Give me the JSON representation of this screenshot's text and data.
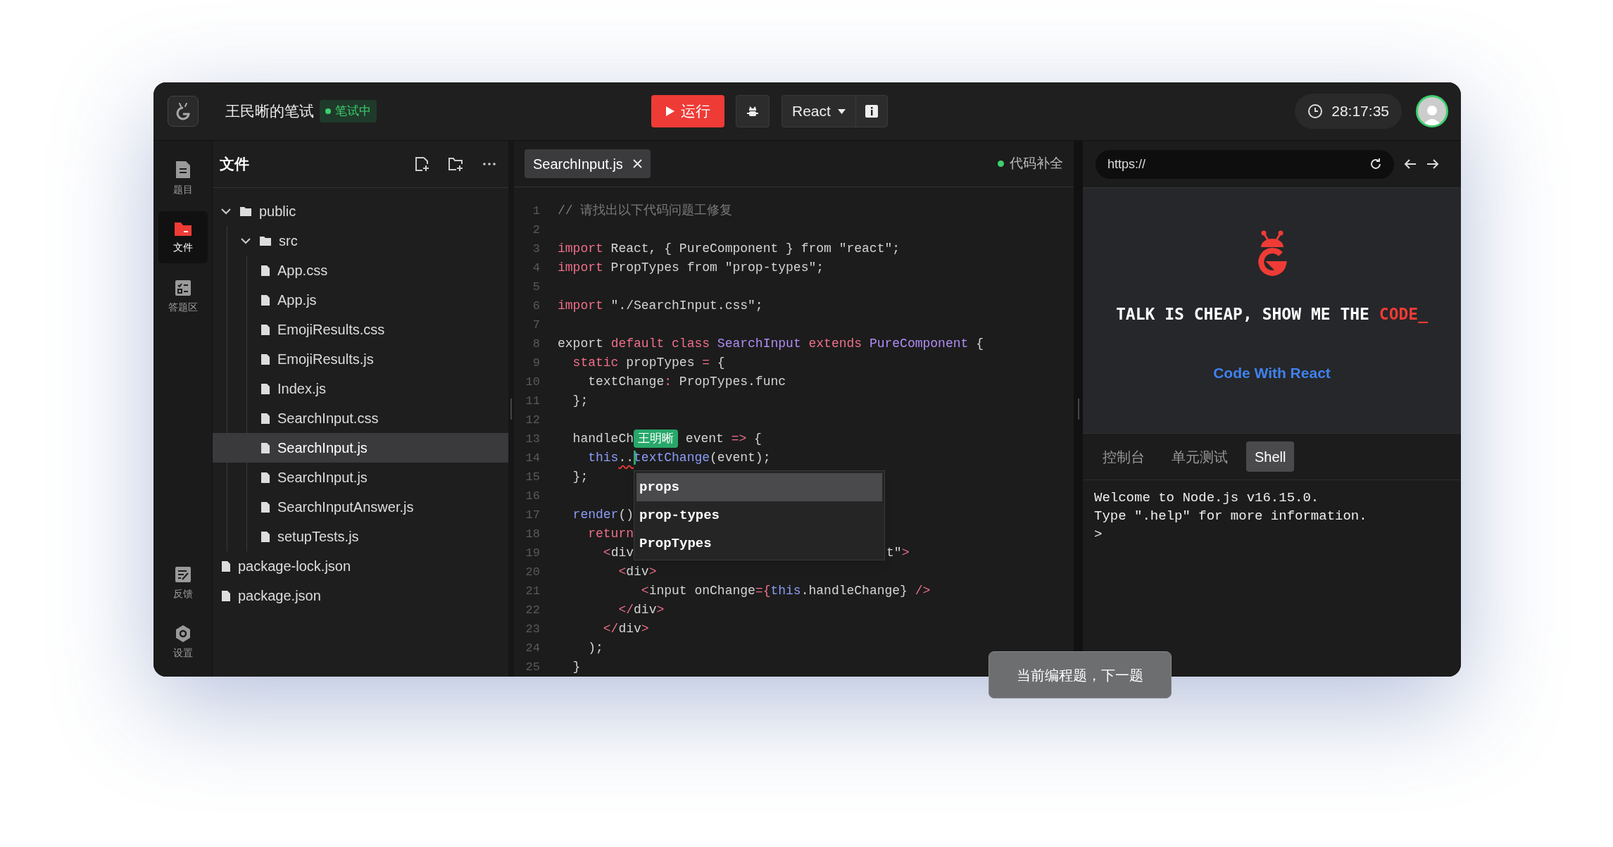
{
  "top_bar": {
    "title": "王民晰的笔试",
    "status": {
      "label": "笔试中",
      "color": "#3ecf6e"
    },
    "run_label": "运行",
    "framework": "React",
    "timer": "28:17:35"
  },
  "sidebar": {
    "items": [
      {
        "label": "题目",
        "kind": "document",
        "selected": false
      },
      {
        "label": "文件",
        "kind": "folder",
        "selected": true
      },
      {
        "label": "答题区",
        "kind": "checklist",
        "selected": false
      }
    ],
    "bottom_items": [
      {
        "label": "反馈",
        "kind": "feedback",
        "selected": false
      },
      {
        "label": "设置",
        "kind": "settings",
        "selected": false
      }
    ]
  },
  "files": {
    "title": "文件",
    "tree": [
      {
        "name": "public",
        "kind": "folder",
        "expanded": true,
        "selected": false,
        "children": [
          {
            "name": "src",
            "kind": "folder",
            "expanded": true,
            "selected": false,
            "children": [
              {
                "name": "App.css",
                "kind": "file",
                "selected": false
              },
              {
                "name": "App.js",
                "kind": "file",
                "selected": false
              },
              {
                "name": "EmojiResults.css",
                "kind": "file",
                "selected": false
              },
              {
                "name": "EmojiResults.js",
                "kind": "file",
                "selected": false
              },
              {
                "name": "Index.js",
                "kind": "file",
                "selected": false
              },
              {
                "name": "SearchInput.css",
                "kind": "file",
                "selected": false
              },
              {
                "name": "SearchInput.js",
                "kind": "file",
                "selected": true
              },
              {
                "name": "SearchInput.js",
                "kind": "file",
                "selected": false
              },
              {
                "name": "SearchInputAnswer.js",
                "kind": "file",
                "selected": false
              },
              {
                "name": "setupTests.js",
                "kind": "file",
                "selected": false
              }
            ]
          }
        ]
      },
      {
        "name": "package-lock.json",
        "kind": "file",
        "selected": false
      },
      {
        "name": "package.json",
        "kind": "file",
        "selected": false
      }
    ]
  },
  "editor": {
    "tabs": [
      {
        "label": "SearchInput.js",
        "selected": true
      }
    ],
    "completion": {
      "label": "代码补全",
      "on": true
    },
    "lines": [
      {
        "number": "1",
        "segments": [
          {
            "kind": "comment",
            "text": "// 请找出以下代码问题工修复"
          }
        ]
      },
      {
        "number": "2"
      },
      {
        "number": "3",
        "segments": [
          {
            "kind": "keyword",
            "text": "import"
          },
          {
            "kind": "plain",
            "text": " React, { PureComponent } from \"react\";"
          }
        ]
      },
      {
        "number": "4",
        "segments": [
          {
            "kind": "keyword",
            "text": "import"
          },
          {
            "kind": "plain",
            "text": " PropTypes from \"prop-types\";"
          }
        ]
      },
      {
        "number": "5"
      },
      {
        "number": "6",
        "segments": [
          {
            "kind": "keyword",
            "text": "import"
          },
          {
            "kind": "plain",
            "text": " \"./SearchInput.css\";"
          }
        ]
      },
      {
        "number": "7"
      },
      {
        "number": "8",
        "segments": [
          {
            "kind": "plain",
            "text": "export "
          },
          {
            "kind": "keyword",
            "text": "default class "
          },
          {
            "kind": "type",
            "text": "SearchInput "
          },
          {
            "kind": "keyword",
            "text": "extends "
          },
          {
            "kind": "type",
            "text": "PureComponent"
          },
          {
            "kind": "plain",
            "text": " {"
          }
        ]
      },
      {
        "number": "9",
        "segments": [
          {
            "kind": "keyword",
            "text": "  static"
          },
          {
            "kind": "plain",
            "text": " propTypes "
          },
          {
            "kind": "keyword",
            "text": "="
          },
          {
            "kind": "plain",
            "text": " {"
          }
        ]
      },
      {
        "number": "10",
        "segments": [
          {
            "kind": "plain",
            "text": "    textChange"
          },
          {
            "kind": "keyword",
            "text": ":"
          },
          {
            "kind": "plain",
            "text": " PropTypes.func"
          }
        ]
      },
      {
        "number": "11",
        "segments": [
          {
            "kind": "plain",
            "text": "  };"
          }
        ]
      },
      {
        "number": "12"
      },
      {
        "number": "13",
        "segments": [
          {
            "kind": "plain",
            "text": "  handleCh"
          },
          {
            "kind": "collaborator",
            "text": "王明晰"
          },
          {
            "kind": "plain",
            "text": " event "
          },
          {
            "kind": "keyword",
            "text": "=>"
          },
          {
            "kind": "plain",
            "text": " {"
          }
        ]
      },
      {
        "number": "14",
        "segments": [
          {
            "kind": "ident",
            "text": "    this"
          },
          {
            "kind": "error",
            "text": ".."
          },
          {
            "kind": "ident",
            "text": "textChange"
          },
          {
            "kind": "plain",
            "text": "(event);"
          }
        ]
      },
      {
        "number": "15",
        "segments": [
          {
            "kind": "plain",
            "text": "  };"
          }
        ]
      },
      {
        "number": "16"
      },
      {
        "number": "17",
        "segments": [
          {
            "kind": "ident",
            "text": "  render"
          },
          {
            "kind": "plain",
            "text": "()"
          }
        ]
      },
      {
        "number": "18",
        "segments": [
          {
            "kind": "keyword",
            "text": "    return"
          }
        ]
      },
      {
        "number": "19",
        "segments": [
          {
            "kind": "keyword",
            "text": "      <"
          },
          {
            "kind": "plain",
            "text": "div"
          }
        ],
        "tail": [
          {
            "kind": "plain",
            "text": "t\""
          },
          {
            "kind": "keyword",
            "text": ">"
          }
        ]
      },
      {
        "number": "20",
        "segments": [
          {
            "kind": "keyword",
            "text": "        <"
          },
          {
            "kind": "plain",
            "text": "div"
          },
          {
            "kind": "keyword",
            "text": ">"
          }
        ]
      },
      {
        "number": "21",
        "segments": [
          {
            "kind": "keyword",
            "text": "           <"
          },
          {
            "kind": "plain",
            "text": "input onChange"
          },
          {
            "kind": "keyword",
            "text": "={"
          },
          {
            "kind": "ident",
            "text": "this"
          },
          {
            "kind": "plain",
            "text": ".handleChange} "
          },
          {
            "kind": "keyword",
            "text": "/>"
          }
        ]
      },
      {
        "number": "22",
        "segments": [
          {
            "kind": "keyword",
            "text": "        </"
          },
          {
            "kind": "plain",
            "text": "div"
          },
          {
            "kind": "keyword",
            "text": ">"
          }
        ]
      },
      {
        "number": "23",
        "segments": [
          {
            "kind": "keyword",
            "text": "      </"
          },
          {
            "kind": "plain",
            "text": "div"
          },
          {
            "kind": "keyword",
            "text": ">"
          }
        ]
      },
      {
        "number": "24",
        "segments": [
          {
            "kind": "plain",
            "text": "    );"
          }
        ]
      },
      {
        "number": "25",
        "segments": [
          {
            "kind": "plain",
            "text": "  }"
          }
        ]
      }
    ],
    "suggestions": [
      {
        "label": "props",
        "selected": true
      },
      {
        "label": "prop-types",
        "selected": false
      },
      {
        "label": "PropTypes",
        "selected": false
      }
    ]
  },
  "preview": {
    "url": "https://",
    "headline": "TALK IS CHEAP, SHOW ME THE ",
    "headline_highlight": "CODE_",
    "link": "Code With React"
  },
  "console": {
    "tabs": [
      {
        "label": "控制台",
        "selected": false
      },
      {
        "label": "单元测试",
        "selected": false
      },
      {
        "label": "Shell",
        "selected": true
      }
    ],
    "output": [
      "Welcome to Node.js v16.15.0.",
      "Type \".help\" for more information.",
      ">"
    ]
  },
  "toast": "当前编程题，下一题"
}
